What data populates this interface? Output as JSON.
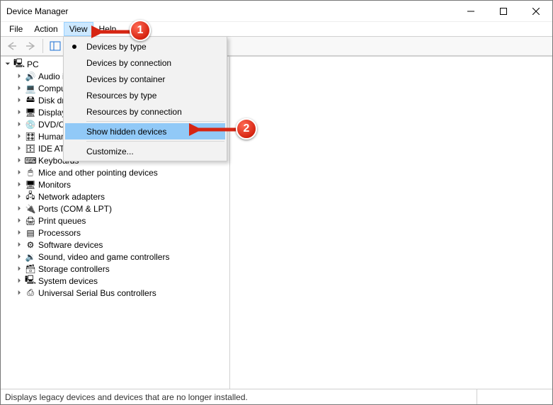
{
  "window": {
    "title": "Device Manager"
  },
  "menubar": {
    "items": [
      "File",
      "Action",
      "View",
      "Help"
    ],
    "open_index": 2
  },
  "dropdown": {
    "groups": [
      {
        "items": [
          "Devices by type",
          "Devices by connection",
          "Devices by container",
          "Resources by type",
          "Resources by connection"
        ],
        "selected_index": 0
      },
      {
        "items": [
          "Show hidden devices"
        ],
        "highlight_index": 0
      },
      {
        "items": [
          "Customize..."
        ]
      }
    ]
  },
  "tree": {
    "root": {
      "label": "PC",
      "children": [
        {
          "label": "Audio inputs and outputs",
          "icon": "audio-icon"
        },
        {
          "label": "Computer",
          "icon": "computer-icon"
        },
        {
          "label": "Disk drives",
          "icon": "disk-icon"
        },
        {
          "label": "Display adapters",
          "icon": "display-icon"
        },
        {
          "label": "DVD/CD-ROM drives",
          "icon": "dvd-icon"
        },
        {
          "label": "Human Interface Devices",
          "icon": "hid-icon"
        },
        {
          "label": "IDE ATA/ATAPI controllers",
          "icon": "ide-icon"
        },
        {
          "label": "Keyboards",
          "icon": "keyboard-icon"
        },
        {
          "label": "Mice and other pointing devices",
          "icon": "mouse-icon"
        },
        {
          "label": "Monitors",
          "icon": "monitor-icon"
        },
        {
          "label": "Network adapters",
          "icon": "network-icon"
        },
        {
          "label": "Ports (COM & LPT)",
          "icon": "ports-icon"
        },
        {
          "label": "Print queues",
          "icon": "print-icon"
        },
        {
          "label": "Processors",
          "icon": "processor-icon"
        },
        {
          "label": "Software devices",
          "icon": "software-icon"
        },
        {
          "label": "Sound, video and game controllers",
          "icon": "sound-icon"
        },
        {
          "label": "Storage controllers",
          "icon": "storage-icon"
        },
        {
          "label": "System devices",
          "icon": "system-icon"
        },
        {
          "label": "Universal Serial Bus controllers",
          "icon": "usb-icon"
        }
      ]
    }
  },
  "status": {
    "text": "Displays legacy devices and devices that are no longer installed."
  },
  "annotations": {
    "badge1": "1",
    "badge2": "2"
  },
  "icons": {
    "audio-icon": "🔊",
    "computer-icon": "💻",
    "disk-icon": "🖴",
    "display-icon": "🖥",
    "dvd-icon": "💿",
    "hid-icon": "🎛",
    "ide-icon": "🗄",
    "keyboard-icon": "⌨",
    "mouse-icon": "🖱",
    "monitor-icon": "🖥",
    "network-icon": "🖧",
    "ports-icon": "🔌",
    "print-icon": "🖨",
    "processor-icon": "▤",
    "software-icon": "⚙",
    "sound-icon": "🔉",
    "storage-icon": "🗃",
    "system-icon": "🖳",
    "usb-icon": "⎙",
    "pc-icon": "🖳"
  }
}
